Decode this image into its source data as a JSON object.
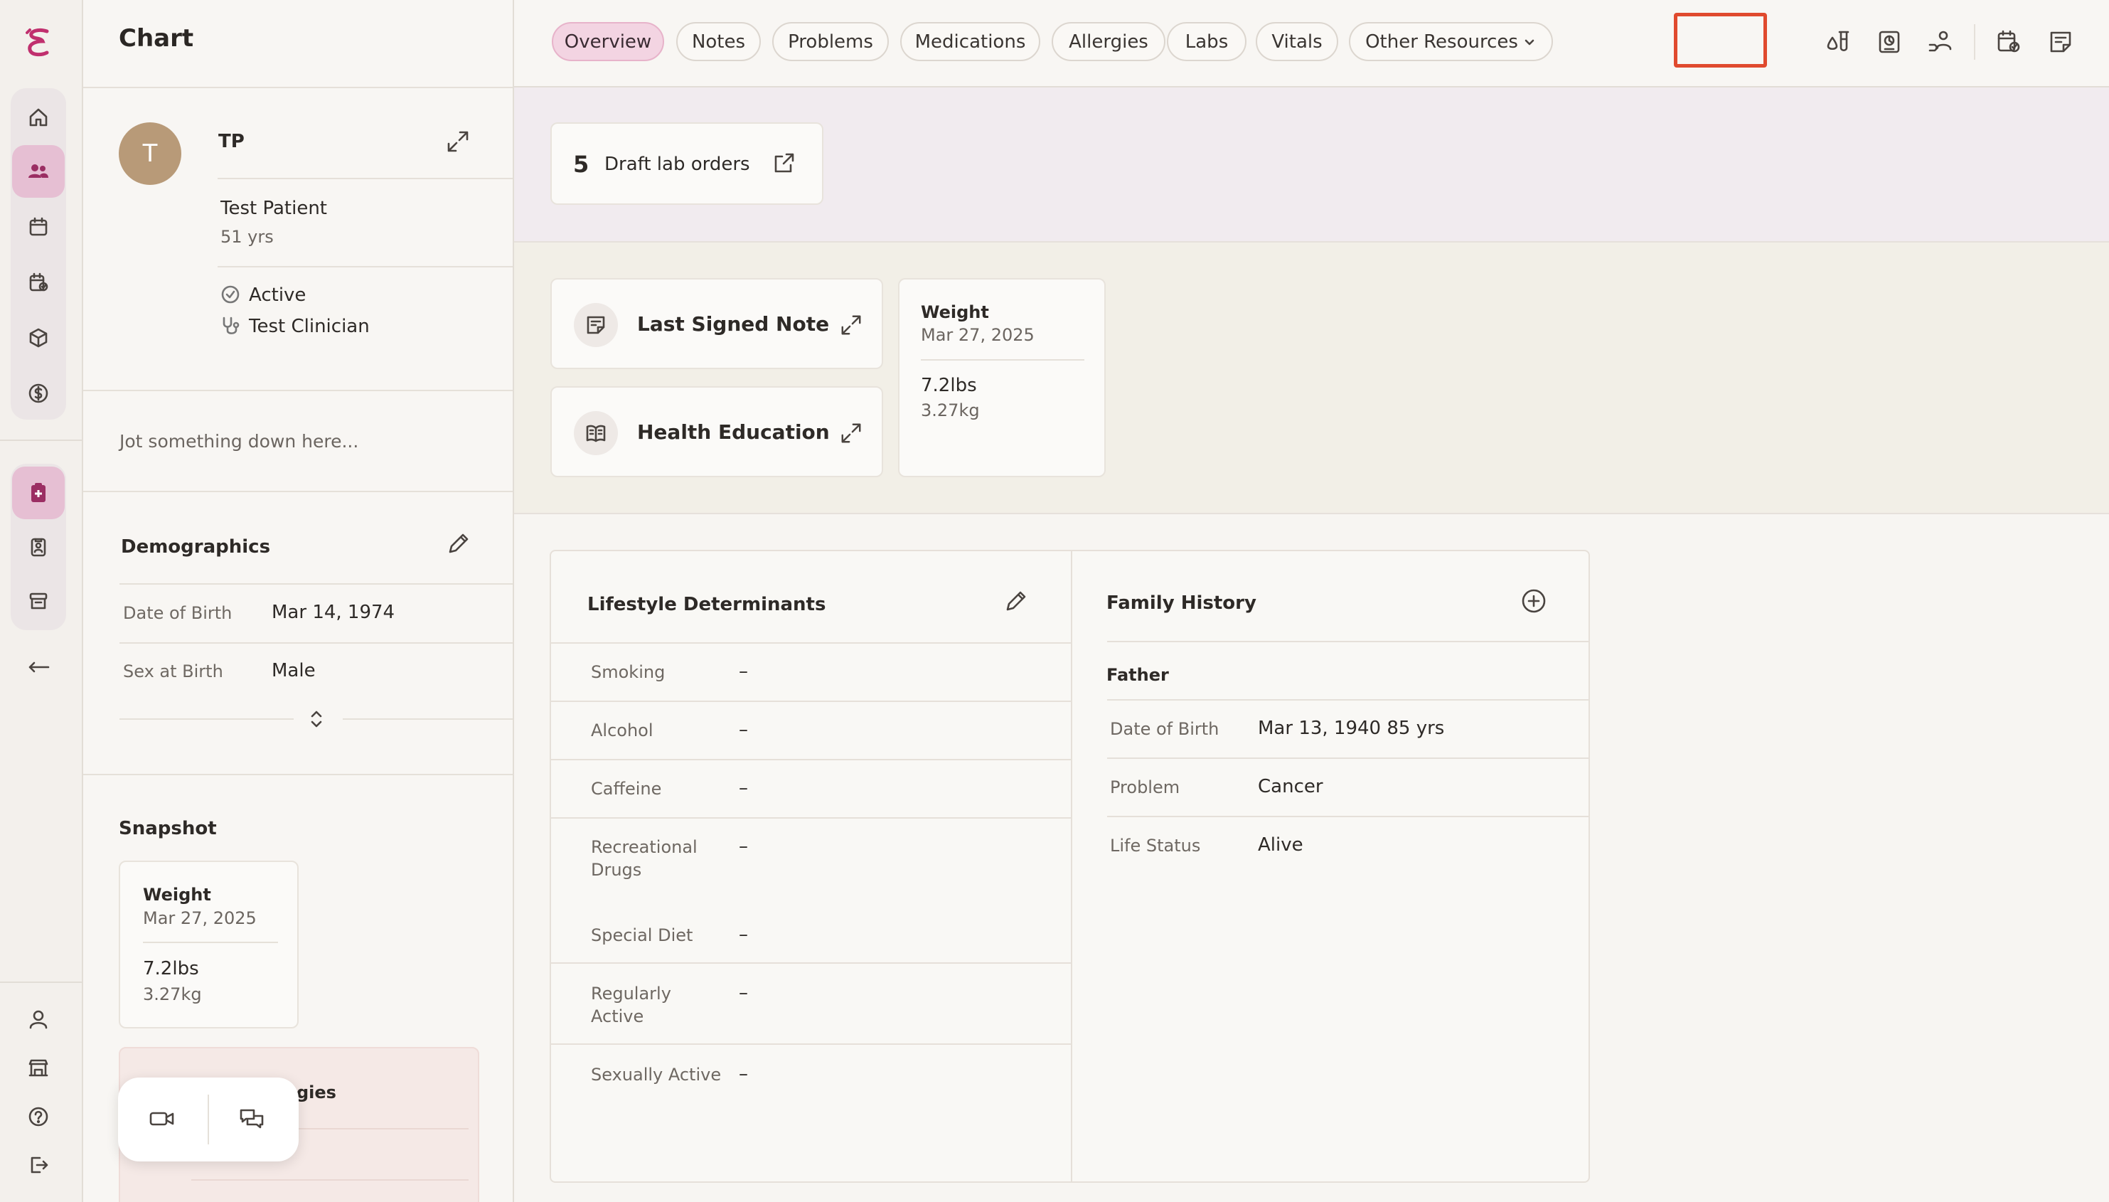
{
  "header": {
    "page_title": "Chart",
    "tabs": [
      {
        "label": "Overview"
      },
      {
        "label": "Notes"
      },
      {
        "label": "Problems"
      },
      {
        "label": "Medications"
      },
      {
        "label": "Allergies"
      },
      {
        "label": "Labs"
      },
      {
        "label": "Vitals"
      },
      {
        "label": "Other Resources"
      }
    ],
    "active_tab": "Overview",
    "highlighted_tab": "Labs",
    "toolbar_icons": [
      "lab-flask-icon",
      "lab-report-icon",
      "patient-access-icon",
      "calendar-check-icon",
      "note-icon"
    ]
  },
  "rail": {
    "nav_icons": [
      "home-icon",
      "patients-icon",
      "calendar-icon",
      "tasks-calendar-icon",
      "packages-icon",
      "billing-icon"
    ],
    "active_nav": "patients-icon",
    "secondary_icons": [
      "medical-plus-icon",
      "patient-badge-icon",
      "archive-icon"
    ],
    "collapse_icon": "arrow-left-icon",
    "bottom_icons": [
      "profile-icon",
      "clinic-icon",
      "help-icon",
      "logout-icon"
    ]
  },
  "patient": {
    "initial": "T",
    "initials": "TP",
    "name": "Test Patient",
    "age": "51 yrs",
    "status": "Active",
    "clinician": "Test Clinician"
  },
  "jot": {
    "placeholder": "Jot something down here..."
  },
  "demographics": {
    "title": "Demographics",
    "rows": [
      {
        "label": "Date of Birth",
        "value": "Mar 14, 1974"
      },
      {
        "label": "Sex at Birth",
        "value": "Male"
      }
    ]
  },
  "snapshot": {
    "title": "Snapshot",
    "weight": {
      "label": "Weight",
      "date": "Mar 27, 2025",
      "lbs": "7.2lbs",
      "kg": "3.27kg"
    },
    "partial_card_text": "gies"
  },
  "draft_labs": {
    "count": "5",
    "label": "Draft lab orders"
  },
  "quick_links": [
    {
      "label": "Last Signed Note"
    },
    {
      "label": "Health Education"
    }
  ],
  "weight_card": {
    "label": "Weight",
    "date": "Mar 27, 2025",
    "lbs": "7.2lbs",
    "kg": "3.27kg"
  },
  "lifestyle": {
    "title": "Lifestyle Determinants",
    "rows": [
      {
        "label": "Smoking",
        "value": "–"
      },
      {
        "label": "Alcohol",
        "value": "–"
      },
      {
        "label": "Caffeine",
        "value": "–"
      },
      {
        "label_line1": "Recreational",
        "label_line2": "Drugs",
        "value": "–"
      },
      {
        "label": "Special Diet",
        "value": "–"
      },
      {
        "label_line1": "Regularly",
        "label_line2": "Active",
        "value": "–"
      },
      {
        "label": "Sexually Active",
        "value": "–"
      }
    ]
  },
  "family_history": {
    "title": "Family History",
    "relation": "Father",
    "rows": [
      {
        "label": "Date of Birth",
        "value": "Mar 13, 1940 85 yrs"
      },
      {
        "label": "Problem",
        "value": "Cancer"
      },
      {
        "label": "Life Status",
        "value": "Alive"
      }
    ]
  },
  "float_bar": {
    "icons": [
      "video-icon",
      "chat-icon"
    ]
  },
  "colors": {
    "accent": "#c0306e",
    "active_tab_bg": "#f3d4e2",
    "highlight": "#e04a2e",
    "avatar": "#b89a78"
  }
}
